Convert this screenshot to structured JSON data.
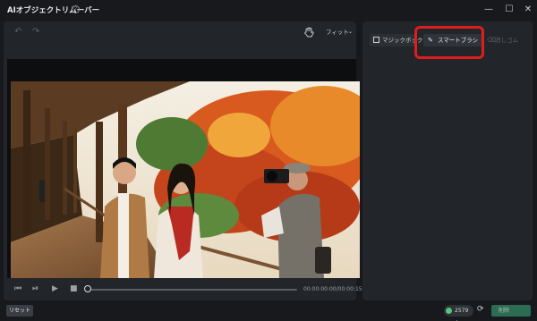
{
  "app": {
    "title": "AIオブジェクトリムーバー",
    "help_icon": "?"
  },
  "window": {
    "minimize": "—",
    "maximize": "☐",
    "close": "✕"
  },
  "toolbar": {
    "undo": "↶",
    "redo": "↷",
    "fit_label": "フィット",
    "fit_chevron": "⌄"
  },
  "player": {
    "prev": "⏮",
    "step": "⏯",
    "play": "▶",
    "stop": "■",
    "progress": 0,
    "timecode": "00:00:00:00/00:00:15:00"
  },
  "tabs": {
    "magic_box": "マジックボック",
    "smart_brush": "スマートブラシ",
    "erase": "消しゴム"
  },
  "bottom": {
    "reset_label": "リセット",
    "credits": "2579",
    "credits_plus": "+",
    "refresh": "⟳",
    "remove_label": "削除"
  },
  "colors": {
    "accent": "#55c57a",
    "highlight": "#e01d1d",
    "primary_button": "#2d6b54"
  }
}
